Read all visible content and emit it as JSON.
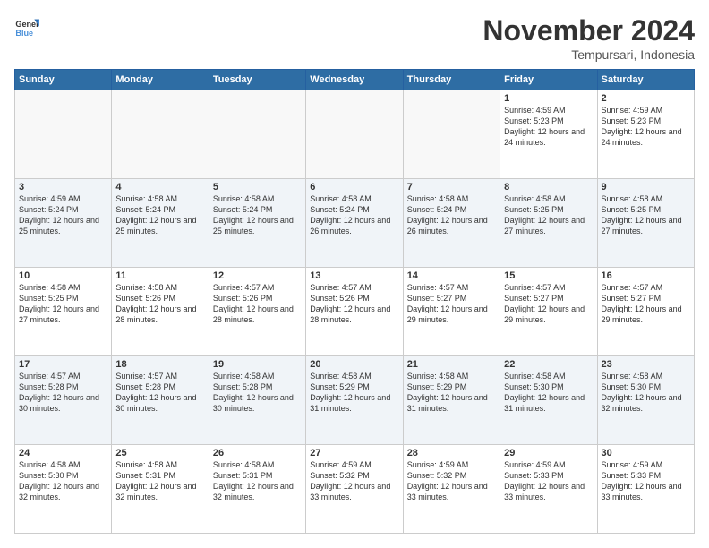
{
  "logo": {
    "line1": "General",
    "line2": "Blue"
  },
  "title": "November 2024",
  "location": "Tempursari, Indonesia",
  "headers": [
    "Sunday",
    "Monday",
    "Tuesday",
    "Wednesday",
    "Thursday",
    "Friday",
    "Saturday"
  ],
  "weeks": [
    [
      {
        "day": "",
        "info": ""
      },
      {
        "day": "",
        "info": ""
      },
      {
        "day": "",
        "info": ""
      },
      {
        "day": "",
        "info": ""
      },
      {
        "day": "",
        "info": ""
      },
      {
        "day": "1",
        "info": "Sunrise: 4:59 AM\nSunset: 5:23 PM\nDaylight: 12 hours and 24 minutes."
      },
      {
        "day": "2",
        "info": "Sunrise: 4:59 AM\nSunset: 5:23 PM\nDaylight: 12 hours and 24 minutes."
      }
    ],
    [
      {
        "day": "3",
        "info": "Sunrise: 4:59 AM\nSunset: 5:24 PM\nDaylight: 12 hours and 25 minutes."
      },
      {
        "day": "4",
        "info": "Sunrise: 4:58 AM\nSunset: 5:24 PM\nDaylight: 12 hours and 25 minutes."
      },
      {
        "day": "5",
        "info": "Sunrise: 4:58 AM\nSunset: 5:24 PM\nDaylight: 12 hours and 25 minutes."
      },
      {
        "day": "6",
        "info": "Sunrise: 4:58 AM\nSunset: 5:24 PM\nDaylight: 12 hours and 26 minutes."
      },
      {
        "day": "7",
        "info": "Sunrise: 4:58 AM\nSunset: 5:24 PM\nDaylight: 12 hours and 26 minutes."
      },
      {
        "day": "8",
        "info": "Sunrise: 4:58 AM\nSunset: 5:25 PM\nDaylight: 12 hours and 27 minutes."
      },
      {
        "day": "9",
        "info": "Sunrise: 4:58 AM\nSunset: 5:25 PM\nDaylight: 12 hours and 27 minutes."
      }
    ],
    [
      {
        "day": "10",
        "info": "Sunrise: 4:58 AM\nSunset: 5:25 PM\nDaylight: 12 hours and 27 minutes."
      },
      {
        "day": "11",
        "info": "Sunrise: 4:58 AM\nSunset: 5:26 PM\nDaylight: 12 hours and 28 minutes."
      },
      {
        "day": "12",
        "info": "Sunrise: 4:57 AM\nSunset: 5:26 PM\nDaylight: 12 hours and 28 minutes."
      },
      {
        "day": "13",
        "info": "Sunrise: 4:57 AM\nSunset: 5:26 PM\nDaylight: 12 hours and 28 minutes."
      },
      {
        "day": "14",
        "info": "Sunrise: 4:57 AM\nSunset: 5:27 PM\nDaylight: 12 hours and 29 minutes."
      },
      {
        "day": "15",
        "info": "Sunrise: 4:57 AM\nSunset: 5:27 PM\nDaylight: 12 hours and 29 minutes."
      },
      {
        "day": "16",
        "info": "Sunrise: 4:57 AM\nSunset: 5:27 PM\nDaylight: 12 hours and 29 minutes."
      }
    ],
    [
      {
        "day": "17",
        "info": "Sunrise: 4:57 AM\nSunset: 5:28 PM\nDaylight: 12 hours and 30 minutes."
      },
      {
        "day": "18",
        "info": "Sunrise: 4:57 AM\nSunset: 5:28 PM\nDaylight: 12 hours and 30 minutes."
      },
      {
        "day": "19",
        "info": "Sunrise: 4:58 AM\nSunset: 5:28 PM\nDaylight: 12 hours and 30 minutes."
      },
      {
        "day": "20",
        "info": "Sunrise: 4:58 AM\nSunset: 5:29 PM\nDaylight: 12 hours and 31 minutes."
      },
      {
        "day": "21",
        "info": "Sunrise: 4:58 AM\nSunset: 5:29 PM\nDaylight: 12 hours and 31 minutes."
      },
      {
        "day": "22",
        "info": "Sunrise: 4:58 AM\nSunset: 5:30 PM\nDaylight: 12 hours and 31 minutes."
      },
      {
        "day": "23",
        "info": "Sunrise: 4:58 AM\nSunset: 5:30 PM\nDaylight: 12 hours and 32 minutes."
      }
    ],
    [
      {
        "day": "24",
        "info": "Sunrise: 4:58 AM\nSunset: 5:30 PM\nDaylight: 12 hours and 32 minutes."
      },
      {
        "day": "25",
        "info": "Sunrise: 4:58 AM\nSunset: 5:31 PM\nDaylight: 12 hours and 32 minutes."
      },
      {
        "day": "26",
        "info": "Sunrise: 4:58 AM\nSunset: 5:31 PM\nDaylight: 12 hours and 32 minutes."
      },
      {
        "day": "27",
        "info": "Sunrise: 4:59 AM\nSunset: 5:32 PM\nDaylight: 12 hours and 33 minutes."
      },
      {
        "day": "28",
        "info": "Sunrise: 4:59 AM\nSunset: 5:32 PM\nDaylight: 12 hours and 33 minutes."
      },
      {
        "day": "29",
        "info": "Sunrise: 4:59 AM\nSunset: 5:33 PM\nDaylight: 12 hours and 33 minutes."
      },
      {
        "day": "30",
        "info": "Sunrise: 4:59 AM\nSunset: 5:33 PM\nDaylight: 12 hours and 33 minutes."
      }
    ]
  ]
}
